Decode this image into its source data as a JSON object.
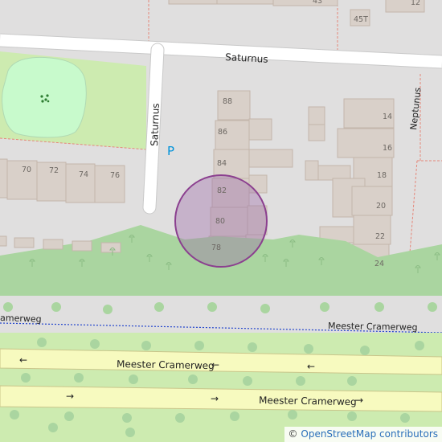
{
  "colors": {
    "background": "#e0dfdf",
    "building": "#d9d0c9",
    "park": "#c8facc",
    "grass": "#aad5a0",
    "road_primary": "#f7fabf",
    "marker_fill": "#9a6aa8",
    "marker_stroke": "#8b3f8f",
    "parking": "#0092da"
  },
  "streets": {
    "saturnus_horizontal": "Saturnus",
    "saturnus_vertical": "Saturnus",
    "neptunus": "Neptunus",
    "cramerweg_service_left": "amerweg",
    "cramerweg_service_right": "Meester Cramerweg",
    "cramerweg_upper": "Meester Cramerweg",
    "cramerweg_lower": "Meester Cramerweg"
  },
  "house_numbers": {
    "top_43": "43",
    "top_12": "12",
    "top_45t": "45T",
    "n70": "70",
    "n72": "72",
    "n74": "74",
    "n76": "76",
    "n88": "88",
    "n86": "86",
    "n84": "84",
    "n82": "82",
    "n80": "80",
    "n78": "78",
    "n14": "14",
    "n16": "16",
    "n18": "18",
    "n20": "20",
    "n22": "22",
    "n24": "24"
  },
  "parking_label": "P",
  "oneway_arrows": {
    "left": "←",
    "right": "→"
  },
  "attribution": {
    "copyright": "©",
    "link_text": "OpenStreetMap contributors"
  }
}
